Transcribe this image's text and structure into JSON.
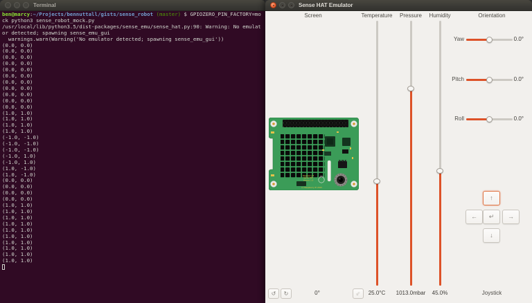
{
  "terminal": {
    "title": "Terminal",
    "prompt_line": [
      {
        "text": "ben@marcy",
        "color": "#8ae234",
        "bold": true
      },
      {
        "text": ":",
        "color": "#d3d7cf"
      },
      {
        "text": "~/Projects/bennuttall/gists/sense_robot",
        "color": "#729fcf",
        "bold": true
      },
      {
        "text": " ",
        "color": "#d3d7cf"
      },
      {
        "text": "(master)",
        "color": "#4e9a06"
      },
      {
        "text": " $ GPIOZERO_PIN_FACTORY=mo",
        "color": "#d3d7cf"
      }
    ],
    "output": [
      {
        "text": "ck python3 sense_robot_mock.py",
        "repeat": 1
      },
      {
        "text": "/usr/local/lib/python3.5/dist-packages/sense_emu/sense_hat.py:90: Warning: No emulat",
        "repeat": 1
      },
      {
        "text": "or detected; spawning sense_emu_gui",
        "repeat": 1
      },
      {
        "text": "  warnings.warn(Warning('No emulator detected; spawning sense_emu_gui'))",
        "repeat": 1
      },
      {
        "text": "(0.0, 0.0)",
        "repeat": 11
      },
      {
        "text": "(1.0, 1.0)",
        "repeat": 4
      },
      {
        "text": "(-1.0, -1.0)",
        "repeat": 3
      },
      {
        "text": "(-1.0, 1.0)",
        "repeat": 2
      },
      {
        "text": "(1.0, -1.0)",
        "repeat": 2
      },
      {
        "text": "(0.0, 0.0)",
        "repeat": 4
      },
      {
        "text": "(1.0, 1.0)",
        "repeat": 10
      }
    ],
    "colors": {
      "background": "#300a24",
      "foreground": "#d3d7cf"
    }
  },
  "emulator": {
    "title": "Sense HAT Emulator",
    "sections": {
      "screen": "Screen",
      "temperature": "Temperature",
      "pressure": "Pressure",
      "humidity": "Humidity",
      "orientation": "Orientation"
    },
    "sliders": {
      "temperature": {
        "value": "25.0°C"
      },
      "pressure": {
        "value": "1013.0mbar"
      },
      "humidity": {
        "value": "45.0%"
      }
    },
    "orientation": {
      "yaw": {
        "label": "Yaw",
        "value": "0.0°"
      },
      "pitch": {
        "label": "Pitch",
        "value": "0.0°"
      },
      "roll": {
        "label": "Roll",
        "value": "0.0°"
      }
    },
    "screen_controls": {
      "rotation": "0°",
      "rotate_left_icon": "↺",
      "rotate_right_icon": "↻",
      "resize_icon": "⇙"
    },
    "joystick": {
      "label": "Joystick",
      "up": "↑",
      "down": "↓",
      "left": "←",
      "right": "→",
      "enter": "↵"
    },
    "board": {
      "line1": "Raspberry Pi",
      "line2": "Sense HAT",
      "line3": "Version 1.0",
      "copyright": "(c) Raspberry Pi 2015"
    },
    "colors": {
      "accent_orange": "#dd5228",
      "track_gray": "#ccc9c3",
      "pcb_green": "#3b9c58"
    }
  }
}
